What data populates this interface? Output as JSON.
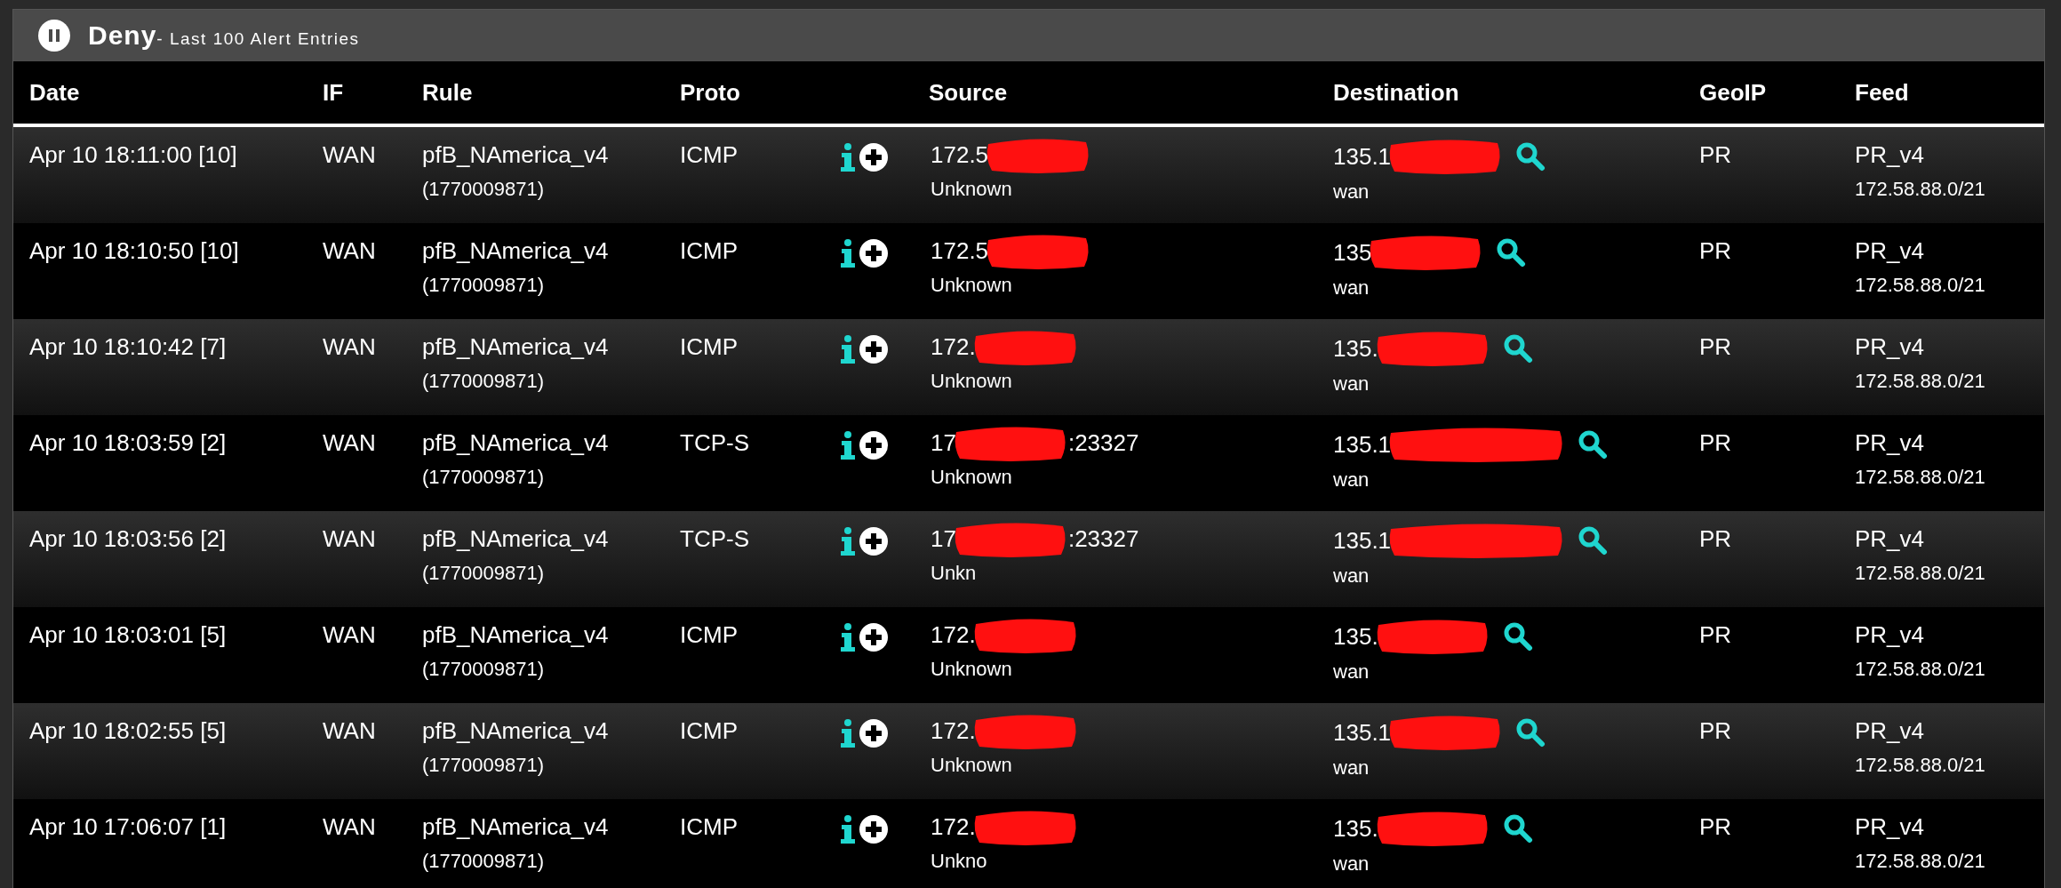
{
  "panel": {
    "title": "Deny",
    "subtitle": "- Last 100 Alert Entries"
  },
  "table": {
    "columns": [
      "Date",
      "IF",
      "Rule",
      "Proto",
      "Source",
      "Destination",
      "GeoIP",
      "Feed"
    ],
    "rows": [
      {
        "date": "Apr 10 18:11:00 [10]",
        "if": "WAN",
        "rule": "pfB_NAmerica_v4",
        "rule_id": "(1770009871)",
        "proto": "ICMP",
        "source": {
          "prefix": "172.5",
          "redacted": true
        },
        "source_host": "Unknown",
        "destination": {
          "prefix": "135.1",
          "redacted": true
        },
        "dest_if": "wan",
        "geoip": "PR",
        "feed": "PR_v4",
        "feed_range": "172.58.88.0/21"
      },
      {
        "date": "Apr 10 18:10:50 [10]",
        "if": "WAN",
        "rule": "pfB_NAmerica_v4",
        "rule_id": "(1770009871)",
        "proto": "ICMP",
        "source": {
          "prefix": "172.5",
          "redacted": true
        },
        "source_host": "Unknown",
        "destination": {
          "prefix": "135",
          "redacted": true
        },
        "dest_if": "wan",
        "geoip": "PR",
        "feed": "PR_v4",
        "feed_range": "172.58.88.0/21"
      },
      {
        "date": "Apr 10 18:10:42 [7]",
        "if": "WAN",
        "rule": "pfB_NAmerica_v4",
        "rule_id": "(1770009871)",
        "proto": "ICMP",
        "source": {
          "prefix": "172.",
          "redacted": true
        },
        "source_host": "Unknown",
        "destination": {
          "prefix": "135.",
          "redacted": true
        },
        "dest_if": "wan",
        "geoip": "PR",
        "feed": "PR_v4",
        "feed_range": "172.58.88.0/21"
      },
      {
        "date": "Apr 10 18:03:59 [2]",
        "if": "WAN",
        "rule": "pfB_NAmerica_v4",
        "rule_id": "(1770009871)",
        "proto": "TCP-S",
        "source": {
          "prefix": "17",
          "suffix": ":23327",
          "redacted": true
        },
        "source_host": "Unknown",
        "destination": {
          "prefix": "135.1",
          "redacted": true
        },
        "dest_if": "wan",
        "geoip": "PR",
        "feed": "PR_v4",
        "feed_range": "172.58.88.0/21"
      },
      {
        "date": "Apr 10 18:03:56 [2]",
        "if": "WAN",
        "rule": "pfB_NAmerica_v4",
        "rule_id": "(1770009871)",
        "proto": "TCP-S",
        "source": {
          "prefix": "17",
          "suffix": ":23327",
          "redacted": true
        },
        "source_host": "Unkn",
        "destination": {
          "prefix": "135.1",
          "redacted": true
        },
        "dest_if": "wan",
        "geoip": "PR",
        "feed": "PR_v4",
        "feed_range": "172.58.88.0/21"
      },
      {
        "date": "Apr 10 18:03:01 [5]",
        "if": "WAN",
        "rule": "pfB_NAmerica_v4",
        "rule_id": "(1770009871)",
        "proto": "ICMP",
        "source": {
          "prefix": "172.",
          "redacted": true
        },
        "source_host": "Unknown",
        "destination": {
          "prefix": "135.",
          "redacted": true
        },
        "dest_if": "wan",
        "geoip": "PR",
        "feed": "PR_v4",
        "feed_range": "172.58.88.0/21"
      },
      {
        "date": "Apr 10 18:02:55 [5]",
        "if": "WAN",
        "rule": "pfB_NAmerica_v4",
        "rule_id": "(1770009871)",
        "proto": "ICMP",
        "source": {
          "prefix": "172.",
          "redacted": true
        },
        "source_host": "Unknown",
        "destination": {
          "prefix": "135.1",
          "redacted": true
        },
        "dest_if": "wan",
        "geoip": "PR",
        "feed": "PR_v4",
        "feed_range": "172.58.88.0/21"
      },
      {
        "date": "Apr 10 17:06:07 [1]",
        "if": "WAN",
        "rule": "pfB_NAmerica_v4",
        "rule_id": "(1770009871)",
        "proto": "ICMP",
        "source": {
          "prefix": "172.",
          "redacted": true
        },
        "source_host": "Unkno",
        "destination": {
          "prefix": "135.",
          "redacted": true
        },
        "dest_if": "wan",
        "geoip": "PR",
        "feed": "PR_v4",
        "feed_range": "172.58.88.0/21"
      }
    ]
  }
}
